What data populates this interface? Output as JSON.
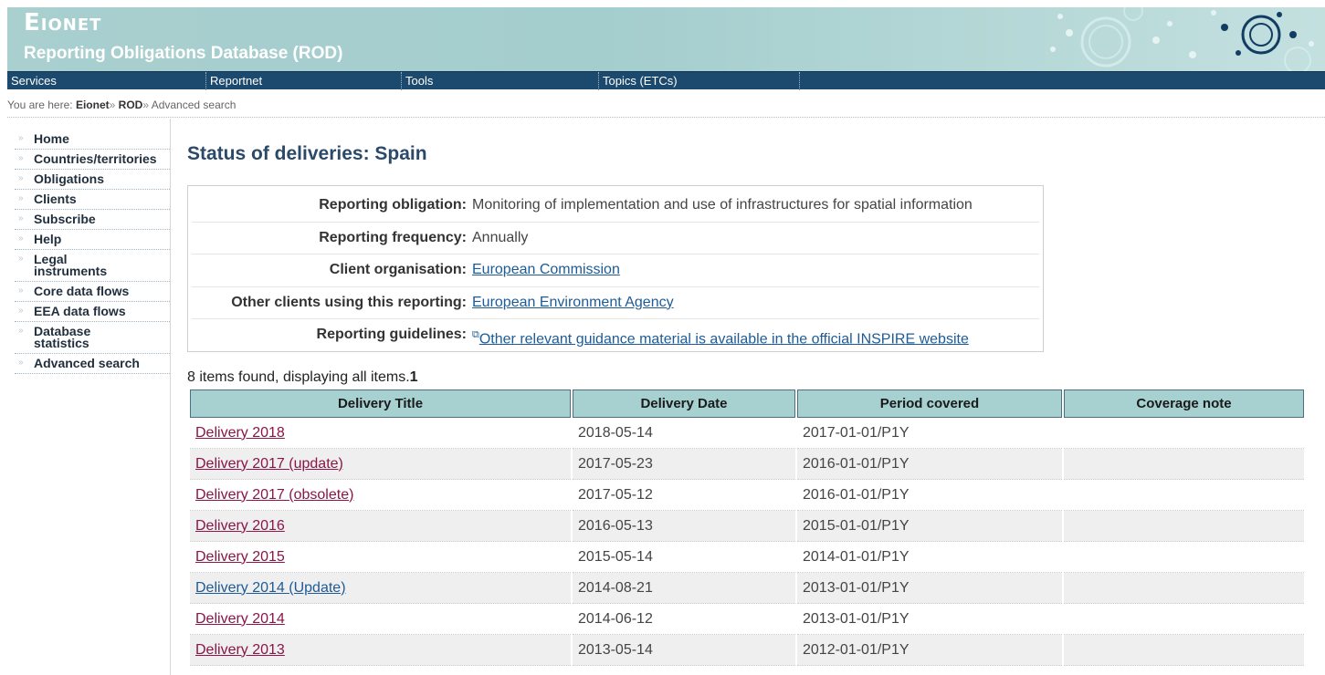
{
  "header": {
    "site_name": "Eionet",
    "subtitle": "Reporting Obligations Database (ROD)"
  },
  "nav": [
    "Services",
    "Reportnet",
    "Tools",
    "Topics (ETCs)"
  ],
  "breadcrumb": {
    "prefix": "You are here:",
    "items": [
      "Eionet",
      "ROD",
      "Advanced search"
    ],
    "separator": "»"
  },
  "menu": [
    "Home",
    "Countries/territories",
    "Obligations",
    "Clients",
    "Subscribe",
    "Help",
    "Legal instruments",
    "Core data flows",
    "EEA data flows",
    "Database statistics",
    "Advanced search"
  ],
  "page_title": "Status of deliveries: Spain",
  "info": {
    "reporting_obligation": {
      "label": "Reporting obligation:",
      "value": "Monitoring of implementation and use of infrastructures for spatial information"
    },
    "reporting_frequency": {
      "label": "Reporting frequency:",
      "value": "Annually"
    },
    "client_organisation": {
      "label": "Client organisation:",
      "value": "European Commission"
    },
    "other_clients": {
      "label": "Other clients using this reporting:",
      "value": "European Environment Agency"
    },
    "guidelines": {
      "label": "Reporting guidelines:",
      "value": "Other relevant guidance material is available in the official INSPIRE website"
    }
  },
  "items_found": {
    "text": "8 items found, displaying all items.",
    "page": "1"
  },
  "table": {
    "headers": [
      "Delivery Title",
      "Delivery Date",
      "Period covered",
      "Coverage note"
    ],
    "rows": [
      {
        "title": "Delivery 2018",
        "date": "2018-05-14",
        "period": "2017-01-01/P1Y",
        "note": "",
        "visited": true
      },
      {
        "title": "Delivery 2017 (update)",
        "date": "2017-05-23",
        "period": "2016-01-01/P1Y",
        "note": "",
        "visited": true
      },
      {
        "title": "Delivery 2017 (obsolete)",
        "date": "2017-05-12",
        "period": "2016-01-01/P1Y",
        "note": "",
        "visited": true
      },
      {
        "title": "Delivery 2016",
        "date": "2016-05-13",
        "period": "2015-01-01/P1Y",
        "note": "",
        "visited": true
      },
      {
        "title": "Delivery 2015",
        "date": "2015-05-14",
        "period": "2014-01-01/P1Y",
        "note": "",
        "visited": true
      },
      {
        "title": "Delivery 2014 (Update)",
        "date": "2014-08-21",
        "period": "2013-01-01/P1Y",
        "note": "",
        "visited": false
      },
      {
        "title": "Delivery 2014",
        "date": "2014-06-12",
        "period": "2013-01-01/P1Y",
        "note": "",
        "visited": true
      },
      {
        "title": "Delivery 2013",
        "date": "2013-05-14",
        "period": "2012-01-01/P1Y",
        "note": "",
        "visited": true
      }
    ]
  },
  "colors": {
    "header_bg": "#a9cfcf",
    "navbar_bg": "#1c4a6e",
    "title": "#2b4a6a",
    "link": "#1d5b97",
    "visited_link": "#8a1546",
    "table_header_bg": "#a7d0d1"
  }
}
